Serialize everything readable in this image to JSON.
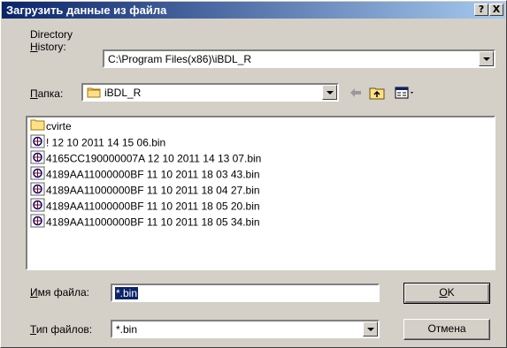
{
  "window": {
    "title": "Загрузить данные из файла",
    "help": "?",
    "close": "X"
  },
  "directory_history": {
    "label_line1": "Directory",
    "label_line2_u": "H",
    "label_line2_rest": "istory:",
    "value": "C:\\Program Files(x86)\\iBDL_R"
  },
  "folder": {
    "label_u": "П",
    "label_rest": "апка:",
    "value": "iBDL_R"
  },
  "files": [
    {
      "name": "cvirte",
      "type": "folder"
    },
    {
      "name": "! 12 10 2011 14 15 06.bin",
      "type": "bin"
    },
    {
      "name": "4165CC190000007A 12 10 2011 14 13 07.bin",
      "type": "bin"
    },
    {
      "name": "4189AA11000000BF 11 10 2011 18 03 43.bin",
      "type": "bin"
    },
    {
      "name": "4189AA11000000BF 11 10 2011 18 04 27.bin",
      "type": "bin"
    },
    {
      "name": "4189AA11000000BF 11 10 2011 18 05 20.bin",
      "type": "bin"
    },
    {
      "name": "4189AA11000000BF 11 10 2011 18 05 34.bin",
      "type": "bin"
    }
  ],
  "filename": {
    "label_u": "И",
    "label_rest": "мя файла:",
    "value": "*.bin"
  },
  "filetype": {
    "label_u": "Т",
    "label_rest": "ип файлов:",
    "value": "*.bin"
  },
  "buttons": {
    "ok_u": "O",
    "ok_rest": "K",
    "cancel": "Отмена"
  },
  "colors": {
    "title_start": "#0a246a",
    "title_end": "#a6caf0",
    "face": "#d4d0c8",
    "selection": "#0a246a"
  }
}
